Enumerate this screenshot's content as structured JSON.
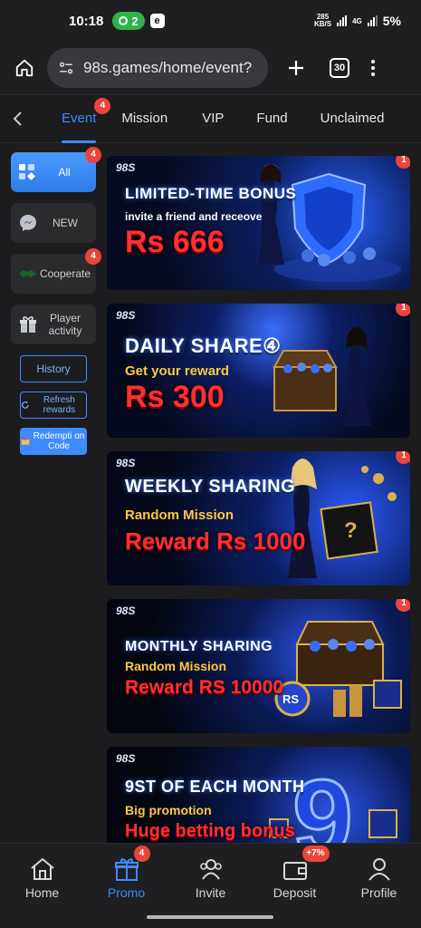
{
  "status": {
    "time": "10:18",
    "hotspot_count": "2",
    "app_letter": "e",
    "net_speed_top": "285",
    "net_speed_bottom": "KB/S",
    "lte": "4G",
    "battery": "5%"
  },
  "browser": {
    "url": "98s.games/home/event?",
    "tab_count": "30"
  },
  "tabs": [
    {
      "label": "Event",
      "badge": "4"
    },
    {
      "label": "Mission"
    },
    {
      "label": "VIP"
    },
    {
      "label": "Fund"
    },
    {
      "label": "Unclaimed"
    }
  ],
  "sidebar": {
    "items": [
      {
        "label": "All",
        "badge": "4"
      },
      {
        "label": "NEW"
      },
      {
        "label": "Cooperate",
        "badge": "4"
      },
      {
        "label": "Player activity"
      }
    ],
    "history": "History",
    "refresh": "Refresh rewards",
    "redeem": "Redempti on Code"
  },
  "banners": [
    {
      "logo": "98S",
      "title": "LIMITED-TIME BONUS",
      "subtitle": "invite a friend and receove",
      "amount": "Rs 666",
      "badge": "1"
    },
    {
      "logo": "98S",
      "title": "DAILY SHARE④",
      "subtitle": "Get your reward",
      "amount": "Rs 300",
      "badge": "1"
    },
    {
      "logo": "98S",
      "title": "WEEKLY SHARING",
      "subtitle": "Random Mission",
      "amount": "Reward Rs 1000",
      "badge": "1"
    },
    {
      "logo": "98S",
      "title": "MONTHLY SHARING",
      "subtitle": "Random Mission",
      "amount": "Reward RS 10000",
      "badge": "1"
    },
    {
      "logo": "98S",
      "title": "9ST OF EACH MONTH",
      "subtitle": "Big promotion",
      "amount": "Huge betting bonus"
    }
  ],
  "nav": [
    {
      "label": "Home"
    },
    {
      "label": "Promo",
      "badge": "4"
    },
    {
      "label": "Invite"
    },
    {
      "label": "Deposit",
      "badge": "+7%"
    },
    {
      "label": "Profile"
    }
  ],
  "colors": {
    "accent": "#3d8bff",
    "badge": "#e8453c",
    "background": "#1c1c1e"
  }
}
